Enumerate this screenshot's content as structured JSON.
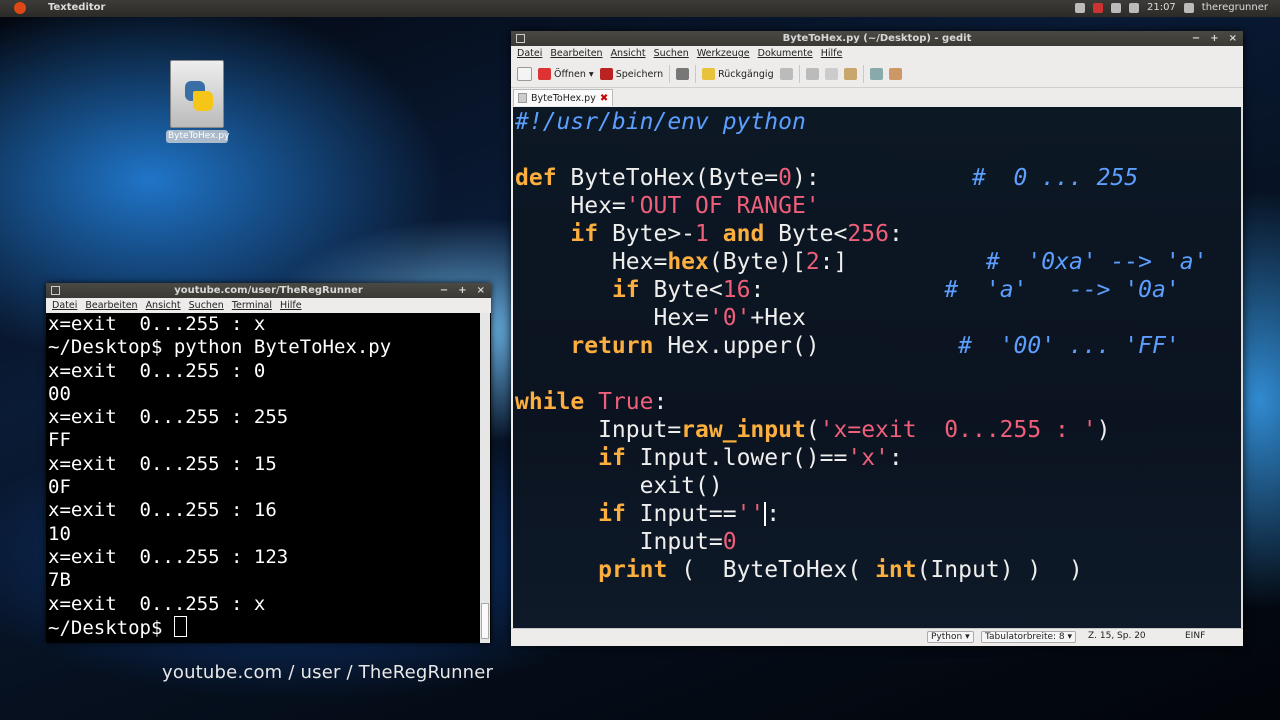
{
  "topbar": {
    "app_title": "Texteditor",
    "time": "21:07",
    "user": "theregrunner"
  },
  "desktop": {
    "file_icon_label": "ByteToHex.py"
  },
  "terminal": {
    "title": "youtube.com/user/TheRegRunner",
    "controls": [
      "−",
      "+",
      "×"
    ],
    "menu": [
      "Datei",
      "Bearbeiten",
      "Ansicht",
      "Suchen",
      "Terminal",
      "Hilfe"
    ],
    "lines": [
      "x=exit  0...255 : x",
      "~/Desktop$ python ByteToHex.py",
      "x=exit  0...255 : 0",
      "00",
      "x=exit  0...255 : 255",
      "FF",
      "x=exit  0...255 : 15",
      "0F",
      "x=exit  0...255 : 16",
      "10",
      "x=exit  0...255 : 123",
      "7B",
      "x=exit  0...255 : x"
    ],
    "prompt": "~/Desktop$ "
  },
  "gedit": {
    "title": "ByteToHex.py (~/Desktop) - gedit",
    "controls": [
      "−",
      "+",
      "×"
    ],
    "menu": [
      "Datei",
      "Bearbeiten",
      "Ansicht",
      "Suchen",
      "Werkzeuge",
      "Dokumente",
      "Hilfe"
    ],
    "toolbar": {
      "open": "Öffnen",
      "save": "Speichern",
      "undo": "Rückgängig"
    },
    "tab_label": "ByteToHex.py",
    "code": {
      "l1": "#!/usr/bin/env python",
      "l3_def": "def",
      "l3_sig": " ByteToHex(Byte=",
      "l3_zero": "0",
      "l3_close": "):",
      "l3_comment": "#  0 ... 255",
      "l4_a": "    Hex=",
      "l4_str": "'OUT OF RANGE'",
      "l5_if": "if",
      "l5_a": " Byte>-",
      "l5_n1": "1",
      "l5_and": "and",
      "l5_b": " Byte<",
      "l5_n2": "256",
      "l5_c": ":",
      "l6_a": "       Hex=",
      "l6_hex": "hex",
      "l6_b": "(Byte)[",
      "l6_n": "2",
      "l6_c": ":]",
      "l6_comment": "#  '0xa' --> 'a'",
      "l7_if": "if",
      "l7_a": " Byte<",
      "l7_n": "16",
      "l7_b": ":",
      "l7_comment": "#  'a'   --> '0a'",
      "l8_a": "          Hex=",
      "l8_str": "'0'",
      "l8_b": "+Hex",
      "l9_ret": "return",
      "l9_a": " Hex.upper()",
      "l9_comment": "#  '00' ... 'FF'",
      "l11_while": "while",
      "l11_true": "True",
      "l11_c": ":",
      "l12_a": "      Input=",
      "l12_fn": "raw_input",
      "l12_b": "(",
      "l12_str": "'x=exit  0...255 : '",
      "l12_c": ")",
      "l13_if": "if",
      "l13_a": " Input.lower()==",
      "l13_str": "'x'",
      "l13_b": ":",
      "l14_a": "         exit()",
      "l15_if": "if",
      "l15_a": " Input==",
      "l15_str": "''",
      "l15_b": ":",
      "l16_a": "         Input=",
      "l16_n": "0",
      "l17_print": "print",
      "l17_a": " (  ByteToHex( ",
      "l17_int": "int",
      "l17_b": "(Input) )  )"
    },
    "status": {
      "language": "Python",
      "tab_width": "Tabulatorbreite: 8",
      "position": "Z. 15, Sp. 20",
      "mode": "EINF"
    }
  },
  "watermark": "youtube.com / user / TheRegRunner",
  "colors": {
    "keyword": "#fcaf3e",
    "string": "#ef5f7a",
    "comment": "#5c9fff",
    "code_bg": "#0d1825"
  }
}
